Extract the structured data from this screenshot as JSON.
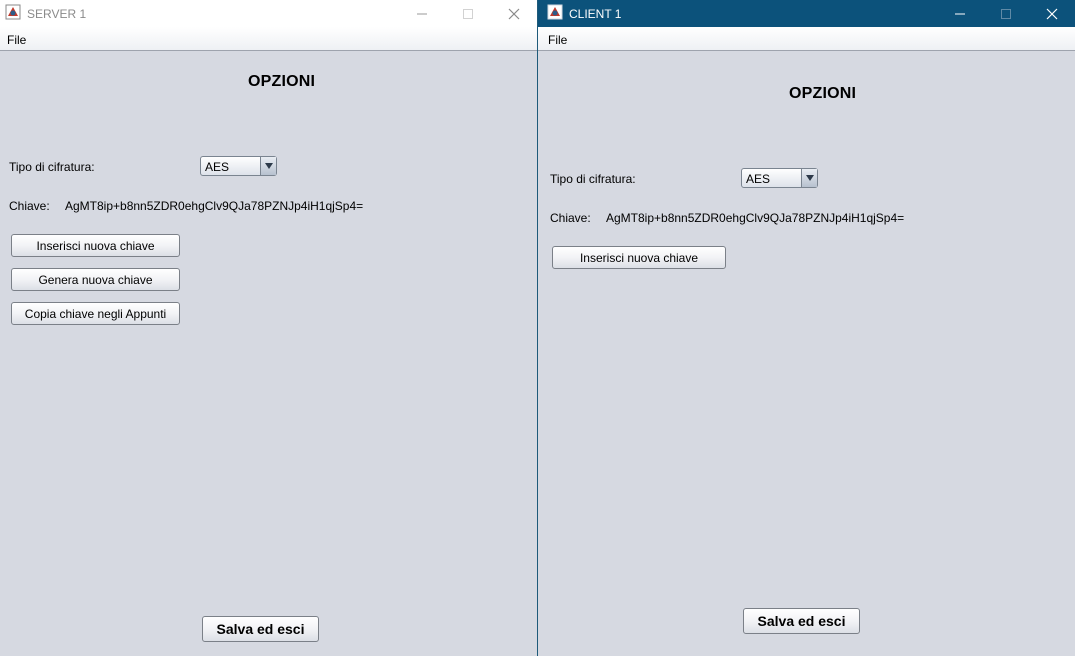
{
  "server": {
    "title": "SERVER 1",
    "menu_file": "File",
    "heading": "OPZIONI",
    "cipher_label": "Tipo di cifratura:",
    "cipher_value": "AES",
    "key_label": "Chiave:",
    "key_value": "AgMT8ip+b8nn5ZDR0ehgClv9QJa78PZNJp4iH1qjSp4=",
    "insert_key_label": "Inserisci nuova chiave",
    "generate_key_label": "Genera nuova chiave",
    "copy_key_label": "Copia chiave negli Appunti",
    "save_label": "Salva ed esci"
  },
  "client": {
    "title": "CLIENT 1",
    "menu_file": "File",
    "heading": "OPZIONI",
    "cipher_label": "Tipo di cifratura:",
    "cipher_value": "AES",
    "key_label": "Chiave:",
    "key_value": "AgMT8ip+b8nn5ZDR0ehgClv9QJa78PZNJp4iH1qjSp4=",
    "insert_key_label": "Inserisci nuova chiave",
    "save_label": "Salva ed esci"
  },
  "icons": {
    "app": "java-app-icon",
    "minimize": "minimize-icon",
    "maximize": "maximize-icon",
    "close": "close-icon",
    "dropdown": "dropdown-arrow-icon"
  },
  "colors": {
    "client_titlebar": "#0c527b",
    "server_titlebar": "#ffffff",
    "window_background": "#d6d9e1"
  }
}
